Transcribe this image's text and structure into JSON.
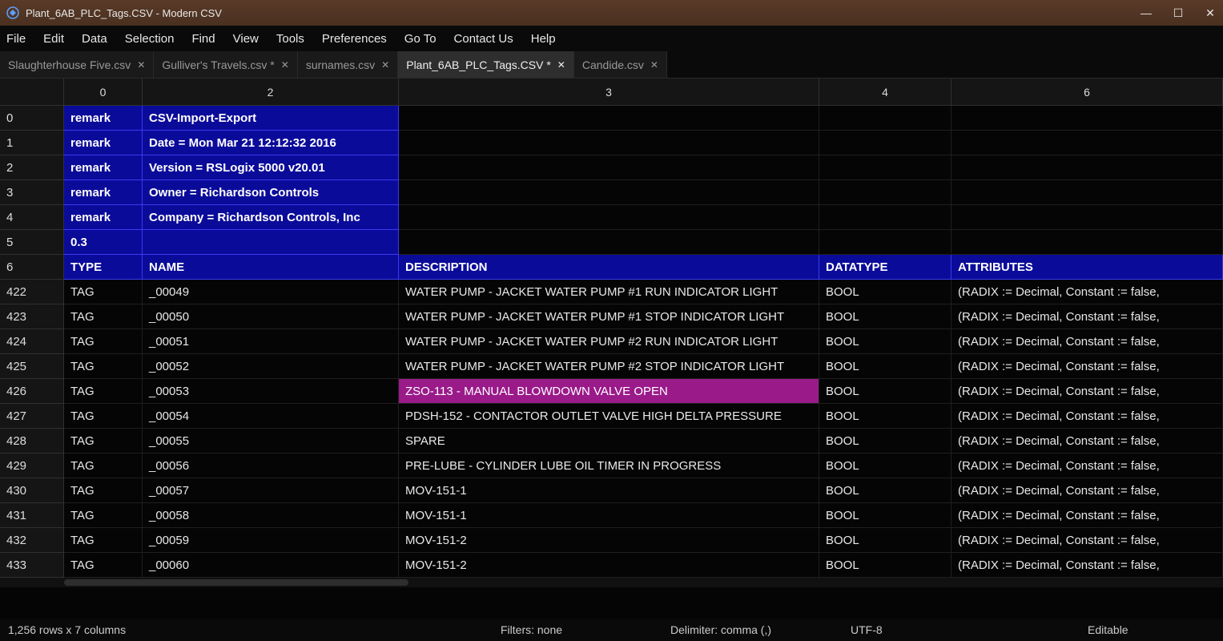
{
  "window": {
    "title": "Plant_6AB_PLC_Tags.CSV - Modern CSV"
  },
  "menu": {
    "items": [
      "File",
      "Edit",
      "Data",
      "Selection",
      "Find",
      "View",
      "Tools",
      "Preferences",
      "Go To",
      "Contact Us",
      "Help"
    ]
  },
  "tabs": [
    {
      "label": "Slaughterhouse Five.csv",
      "modified": false,
      "active": false
    },
    {
      "label": "Gulliver's Travels.csv *",
      "modified": true,
      "active": false
    },
    {
      "label": "surnames.csv",
      "modified": false,
      "active": false
    },
    {
      "label": "Plant_6AB_PLC_Tags.CSV *",
      "modified": true,
      "active": true
    },
    {
      "label": "Candide.csv",
      "modified": false,
      "active": false
    }
  ],
  "grid": {
    "column_headers": [
      "",
      "0",
      "2",
      "3",
      "4",
      "6"
    ],
    "row_headers": [
      "0",
      "1",
      "2",
      "3",
      "4",
      "5",
      "6",
      "422",
      "423",
      "424",
      "425",
      "426",
      "427",
      "428",
      "429",
      "430",
      "431",
      "432",
      "433"
    ],
    "rows": [
      {
        "idx": "0",
        "c0": "remark",
        "c2": "CSV-Import-Export",
        "c3": "",
        "c4": "",
        "c5": "",
        "sel": true
      },
      {
        "idx": "1",
        "c0": "remark",
        "c2": "Date = Mon Mar 21 12:12:32 2016",
        "c3": "",
        "c4": "",
        "c5": "",
        "sel": true
      },
      {
        "idx": "2",
        "c0": "remark",
        "c2": "Version = RSLogix 5000 v20.01",
        "c3": "",
        "c4": "",
        "c5": "",
        "sel": true
      },
      {
        "idx": "3",
        "c0": "remark",
        "c2": "Owner = Richardson Controls",
        "c3": "",
        "c4": "",
        "c5": "",
        "sel": true
      },
      {
        "idx": "4",
        "c0": "remark",
        "c2": "Company = Richardson Controls, Inc",
        "c3": "",
        "c4": "",
        "c5": "",
        "sel": true
      },
      {
        "idx": "5",
        "c0": "0.3",
        "c2": "",
        "c3": "",
        "c4": "",
        "c5": "",
        "sel": true
      },
      {
        "idx": "6",
        "c0": "TYPE",
        "c2": "NAME",
        "c3": "DESCRIPTION",
        "c4": "DATATYPE",
        "c5": "ATTRIBUTES",
        "sel": true,
        "fullsel": true
      },
      {
        "idx": "422",
        "c0": "TAG",
        "c2": "_00049",
        "c3": "WATER PUMP - JACKET WATER PUMP #1 RUN INDICATOR LIGHT",
        "c4": "BOOL",
        "c5": "(RADIX := Decimal, Constant := false,"
      },
      {
        "idx": "423",
        "c0": "TAG",
        "c2": "_00050",
        "c3": "WATER PUMP - JACKET WATER PUMP #1 STOP INDICATOR LIGHT",
        "c4": "BOOL",
        "c5": "(RADIX := Decimal, Constant := false,"
      },
      {
        "idx": "424",
        "c0": "TAG",
        "c2": "_00051",
        "c3": "WATER PUMP - JACKET WATER PUMP #2 RUN INDICATOR LIGHT",
        "c4": "BOOL",
        "c5": "(RADIX := Decimal, Constant := false,"
      },
      {
        "idx": "425",
        "c0": "TAG",
        "c2": "_00052",
        "c3": "WATER PUMP - JACKET WATER PUMP #2 STOP INDICATOR LIGHT",
        "c4": "BOOL",
        "c5": "(RADIX := Decimal, Constant := false,"
      },
      {
        "idx": "426",
        "c0": "TAG",
        "c2": "_00053",
        "c3": "ZSO-113 - MANUAL BLOWDOWN VALVE OPEN",
        "c4": "BOOL",
        "c5": "(RADIX := Decimal, Constant := false,",
        "hl": true
      },
      {
        "idx": "427",
        "c0": "TAG",
        "c2": "_00054",
        "c3": "PDSH-152 - CONTACTOR OUTLET VALVE HIGH DELTA PRESSURE",
        "c4": "BOOL",
        "c5": "(RADIX := Decimal, Constant := false,"
      },
      {
        "idx": "428",
        "c0": "TAG",
        "c2": "_00055",
        "c3": "SPARE",
        "c4": "BOOL",
        "c5": "(RADIX := Decimal, Constant := false,"
      },
      {
        "idx": "429",
        "c0": "TAG",
        "c2": "_00056",
        "c3": "PRE-LUBE - CYLINDER LUBE OIL TIMER IN PROGRESS",
        "c4": "BOOL",
        "c5": "(RADIX := Decimal, Constant := false,"
      },
      {
        "idx": "430",
        "c0": "TAG",
        "c2": "_00057",
        "c3": "MOV-151-1",
        "c4": "BOOL",
        "c5": "(RADIX := Decimal, Constant := false,"
      },
      {
        "idx": "431",
        "c0": "TAG",
        "c2": "_00058",
        "c3": "MOV-151-1",
        "c4": "BOOL",
        "c5": "(RADIX := Decimal, Constant := false,"
      },
      {
        "idx": "432",
        "c0": "TAG",
        "c2": "_00059",
        "c3": "MOV-151-2",
        "c4": "BOOL",
        "c5": "(RADIX := Decimal, Constant := false,"
      },
      {
        "idx": "433",
        "c0": "TAG",
        "c2": "_00060",
        "c3": "MOV-151-2",
        "c4": "BOOL",
        "c5": "(RADIX := Decimal, Constant := false,"
      }
    ]
  },
  "status": {
    "dimensions": "1,256 rows x 7 columns",
    "filters": "Filters: none",
    "delimiter": "Delimiter: comma (,)",
    "encoding": "UTF-8",
    "mode": "Editable"
  }
}
